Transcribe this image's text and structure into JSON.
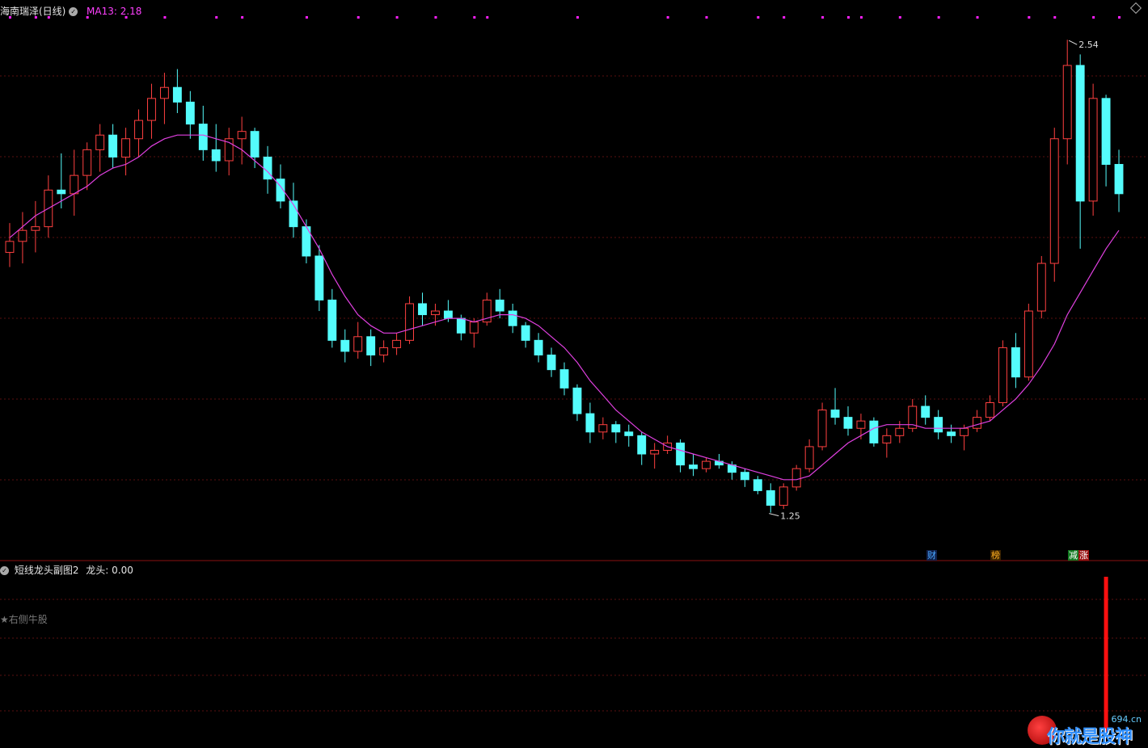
{
  "header": {
    "stock_name": "海南瑞泽(日线)",
    "ma_label": "MA13: 2.18"
  },
  "subchart": {
    "indicator_name": "短线龙头副图2",
    "indicator_value": "龙头: 0.00",
    "star_label": "★右侧牛股"
  },
  "tags": {
    "cai": "财",
    "bang": "榜",
    "jian": "减",
    "zhang": "涨"
  },
  "logo": {
    "slogan": "你就是股神",
    "site": "694.cn"
  },
  "colors": {
    "background": "#000000",
    "up": "#ff4040",
    "down": "#54fcfc",
    "ma": "#e040e0",
    "grid": "#5a1010",
    "signal": "#ff1010",
    "dots": "#ff20ff"
  },
  "chart_data": [
    {
      "type": "candlestick",
      "title": "海南瑞泽(日线)",
      "ylim": [
        1.15,
        2.6
      ],
      "max_label": "2.54",
      "min_label": "1.25",
      "ohlc": [
        [
          1.96,
          2.04,
          1.92,
          1.99
        ],
        [
          1.99,
          2.07,
          1.93,
          2.02
        ],
        [
          2.02,
          2.1,
          1.96,
          2.03
        ],
        [
          2.03,
          2.17,
          2.0,
          2.13
        ],
        [
          2.13,
          2.23,
          2.08,
          2.12
        ],
        [
          2.12,
          2.24,
          2.06,
          2.17
        ],
        [
          2.17,
          2.26,
          2.13,
          2.24
        ],
        [
          2.24,
          2.31,
          2.18,
          2.28
        ],
        [
          2.28,
          2.31,
          2.19,
          2.22
        ],
        [
          2.22,
          2.3,
          2.17,
          2.27
        ],
        [
          2.27,
          2.35,
          2.22,
          2.32
        ],
        [
          2.32,
          2.42,
          2.27,
          2.38
        ],
        [
          2.38,
          2.45,
          2.31,
          2.41
        ],
        [
          2.41,
          2.46,
          2.34,
          2.37
        ],
        [
          2.37,
          2.4,
          2.27,
          2.31
        ],
        [
          2.31,
          2.36,
          2.21,
          2.24
        ],
        [
          2.24,
          2.31,
          2.18,
          2.21
        ],
        [
          2.21,
          2.3,
          2.17,
          2.27
        ],
        [
          2.27,
          2.33,
          2.2,
          2.29
        ],
        [
          2.29,
          2.3,
          2.19,
          2.22
        ],
        [
          2.22,
          2.25,
          2.12,
          2.16
        ],
        [
          2.16,
          2.2,
          2.08,
          2.1
        ],
        [
          2.1,
          2.15,
          2.0,
          2.03
        ],
        [
          2.03,
          2.05,
          1.93,
          1.95
        ],
        [
          1.95,
          1.98,
          1.8,
          1.83
        ],
        [
          1.83,
          1.86,
          1.7,
          1.72
        ],
        [
          1.72,
          1.75,
          1.66,
          1.69
        ],
        [
          1.69,
          1.77,
          1.67,
          1.73
        ],
        [
          1.73,
          1.75,
          1.65,
          1.68
        ],
        [
          1.68,
          1.72,
          1.66,
          1.7
        ],
        [
          1.7,
          1.74,
          1.68,
          1.72
        ],
        [
          1.72,
          1.84,
          1.71,
          1.82
        ],
        [
          1.82,
          1.85,
          1.76,
          1.79
        ],
        [
          1.79,
          1.82,
          1.76,
          1.8
        ],
        [
          1.8,
          1.83,
          1.77,
          1.78
        ],
        [
          1.78,
          1.79,
          1.72,
          1.74
        ],
        [
          1.74,
          1.78,
          1.7,
          1.77
        ],
        [
          1.77,
          1.85,
          1.76,
          1.83
        ],
        [
          1.83,
          1.86,
          1.78,
          1.8
        ],
        [
          1.8,
          1.82,
          1.74,
          1.76
        ],
        [
          1.76,
          1.77,
          1.7,
          1.72
        ],
        [
          1.72,
          1.74,
          1.66,
          1.68
        ],
        [
          1.68,
          1.7,
          1.62,
          1.64
        ],
        [
          1.64,
          1.66,
          1.57,
          1.59
        ],
        [
          1.59,
          1.6,
          1.5,
          1.52
        ],
        [
          1.52,
          1.55,
          1.44,
          1.47
        ],
        [
          1.47,
          1.51,
          1.45,
          1.49
        ],
        [
          1.49,
          1.5,
          1.44,
          1.47
        ],
        [
          1.47,
          1.49,
          1.43,
          1.46
        ],
        [
          1.46,
          1.47,
          1.38,
          1.41
        ],
        [
          1.41,
          1.44,
          1.37,
          1.42
        ],
        [
          1.42,
          1.46,
          1.41,
          1.44
        ],
        [
          1.44,
          1.45,
          1.36,
          1.38
        ],
        [
          1.38,
          1.41,
          1.35,
          1.37
        ],
        [
          1.37,
          1.4,
          1.36,
          1.39
        ],
        [
          1.39,
          1.41,
          1.37,
          1.38
        ],
        [
          1.38,
          1.39,
          1.34,
          1.36
        ],
        [
          1.36,
          1.37,
          1.32,
          1.34
        ],
        [
          1.34,
          1.35,
          1.3,
          1.31
        ],
        [
          1.31,
          1.33,
          1.25,
          1.27
        ],
        [
          1.27,
          1.33,
          1.26,
          1.32
        ],
        [
          1.32,
          1.38,
          1.31,
          1.37
        ],
        [
          1.37,
          1.45,
          1.36,
          1.43
        ],
        [
          1.43,
          1.55,
          1.42,
          1.53
        ],
        [
          1.53,
          1.59,
          1.49,
          1.51
        ],
        [
          1.51,
          1.54,
          1.46,
          1.48
        ],
        [
          1.48,
          1.52,
          1.45,
          1.5
        ],
        [
          1.5,
          1.51,
          1.43,
          1.44
        ],
        [
          1.44,
          1.48,
          1.4,
          1.46
        ],
        [
          1.46,
          1.5,
          1.44,
          1.48
        ],
        [
          1.48,
          1.56,
          1.47,
          1.54
        ],
        [
          1.54,
          1.57,
          1.49,
          1.51
        ],
        [
          1.51,
          1.53,
          1.45,
          1.47
        ],
        [
          1.47,
          1.49,
          1.44,
          1.46
        ],
        [
          1.46,
          1.49,
          1.42,
          1.48
        ],
        [
          1.48,
          1.53,
          1.47,
          1.51
        ],
        [
          1.51,
          1.57,
          1.5,
          1.55
        ],
        [
          1.55,
          1.72,
          1.54,
          1.7
        ],
        [
          1.7,
          1.74,
          1.59,
          1.62
        ],
        [
          1.62,
          1.82,
          1.61,
          1.8
        ],
        [
          1.8,
          1.95,
          1.78,
          1.93
        ],
        [
          1.93,
          2.3,
          1.88,
          2.27
        ],
        [
          2.27,
          2.54,
          2.2,
          2.47
        ],
        [
          2.47,
          2.5,
          1.97,
          2.1
        ],
        [
          2.1,
          2.42,
          2.06,
          2.38
        ],
        [
          2.38,
          2.39,
          2.14,
          2.2
        ],
        [
          2.2,
          2.24,
          2.07,
          2.12
        ]
      ],
      "ma_series": {
        "name": "MA13",
        "values": [
          2.0,
          2.03,
          2.06,
          2.08,
          2.1,
          2.12,
          2.14,
          2.17,
          2.19,
          2.2,
          2.22,
          2.25,
          2.27,
          2.28,
          2.28,
          2.28,
          2.27,
          2.26,
          2.24,
          2.21,
          2.18,
          2.14,
          2.09,
          2.03,
          1.97,
          1.9,
          1.84,
          1.79,
          1.76,
          1.74,
          1.74,
          1.75,
          1.76,
          1.77,
          1.78,
          1.78,
          1.77,
          1.78,
          1.79,
          1.79,
          1.78,
          1.76,
          1.73,
          1.7,
          1.66,
          1.61,
          1.57,
          1.53,
          1.5,
          1.47,
          1.45,
          1.43,
          1.42,
          1.41,
          1.4,
          1.39,
          1.38,
          1.37,
          1.36,
          1.35,
          1.34,
          1.34,
          1.35,
          1.38,
          1.41,
          1.44,
          1.46,
          1.48,
          1.49,
          1.49,
          1.49,
          1.48,
          1.48,
          1.48,
          1.48,
          1.49,
          1.5,
          1.53,
          1.56,
          1.6,
          1.65,
          1.71,
          1.79,
          1.85,
          1.91,
          1.97,
          2.02
        ]
      }
    },
    {
      "type": "bar",
      "title": "短线龙头副图2",
      "series": [
        {
          "name": "龙头",
          "values": [
            1
          ],
          "index": [
            85
          ]
        }
      ]
    }
  ]
}
